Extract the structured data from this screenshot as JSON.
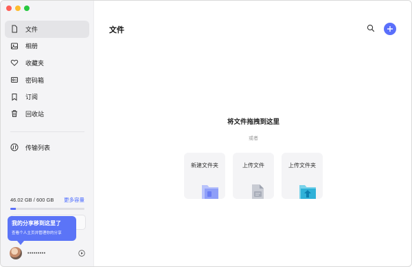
{
  "window": {
    "controls": [
      "close",
      "minimize",
      "zoom"
    ]
  },
  "sidebar": {
    "items": [
      {
        "label": "文件",
        "icon": "file-icon",
        "active": true
      },
      {
        "label": "相册",
        "icon": "photo-icon",
        "active": false
      },
      {
        "label": "收藏夹",
        "icon": "heart-icon",
        "active": false
      },
      {
        "label": "密码箱",
        "icon": "safe-icon",
        "active": false
      },
      {
        "label": "订阅",
        "icon": "bookmark-icon",
        "active": false
      },
      {
        "label": "回收站",
        "icon": "trash-icon",
        "active": false
      }
    ],
    "transfer": {
      "label": "传输列表",
      "icon": "transfer-icon"
    },
    "storage": {
      "usage": "46.02 GB / 600 GB",
      "upgrade_label": "更多容量",
      "used_fraction": 0.077
    },
    "tooltip": {
      "title": "我的分享移到这里了",
      "subtitle": "查看个人主页并管理你的分享"
    },
    "profile": {
      "username": "•••••••••"
    }
  },
  "main": {
    "title": "文件",
    "drop_title": "将文件拖拽到这里",
    "drop_or": "或者",
    "cards": [
      {
        "label": "新建文件夹",
        "icon": "new-folder-icon"
      },
      {
        "label": "上传文件",
        "icon": "upload-file-icon"
      },
      {
        "label": "上传文件夹",
        "icon": "upload-folder-icon"
      }
    ]
  },
  "colors": {
    "accent": "#5a6ffb",
    "sidebar_bg": "#f4f4f6",
    "tooltip_bg": "#5b74f7"
  }
}
